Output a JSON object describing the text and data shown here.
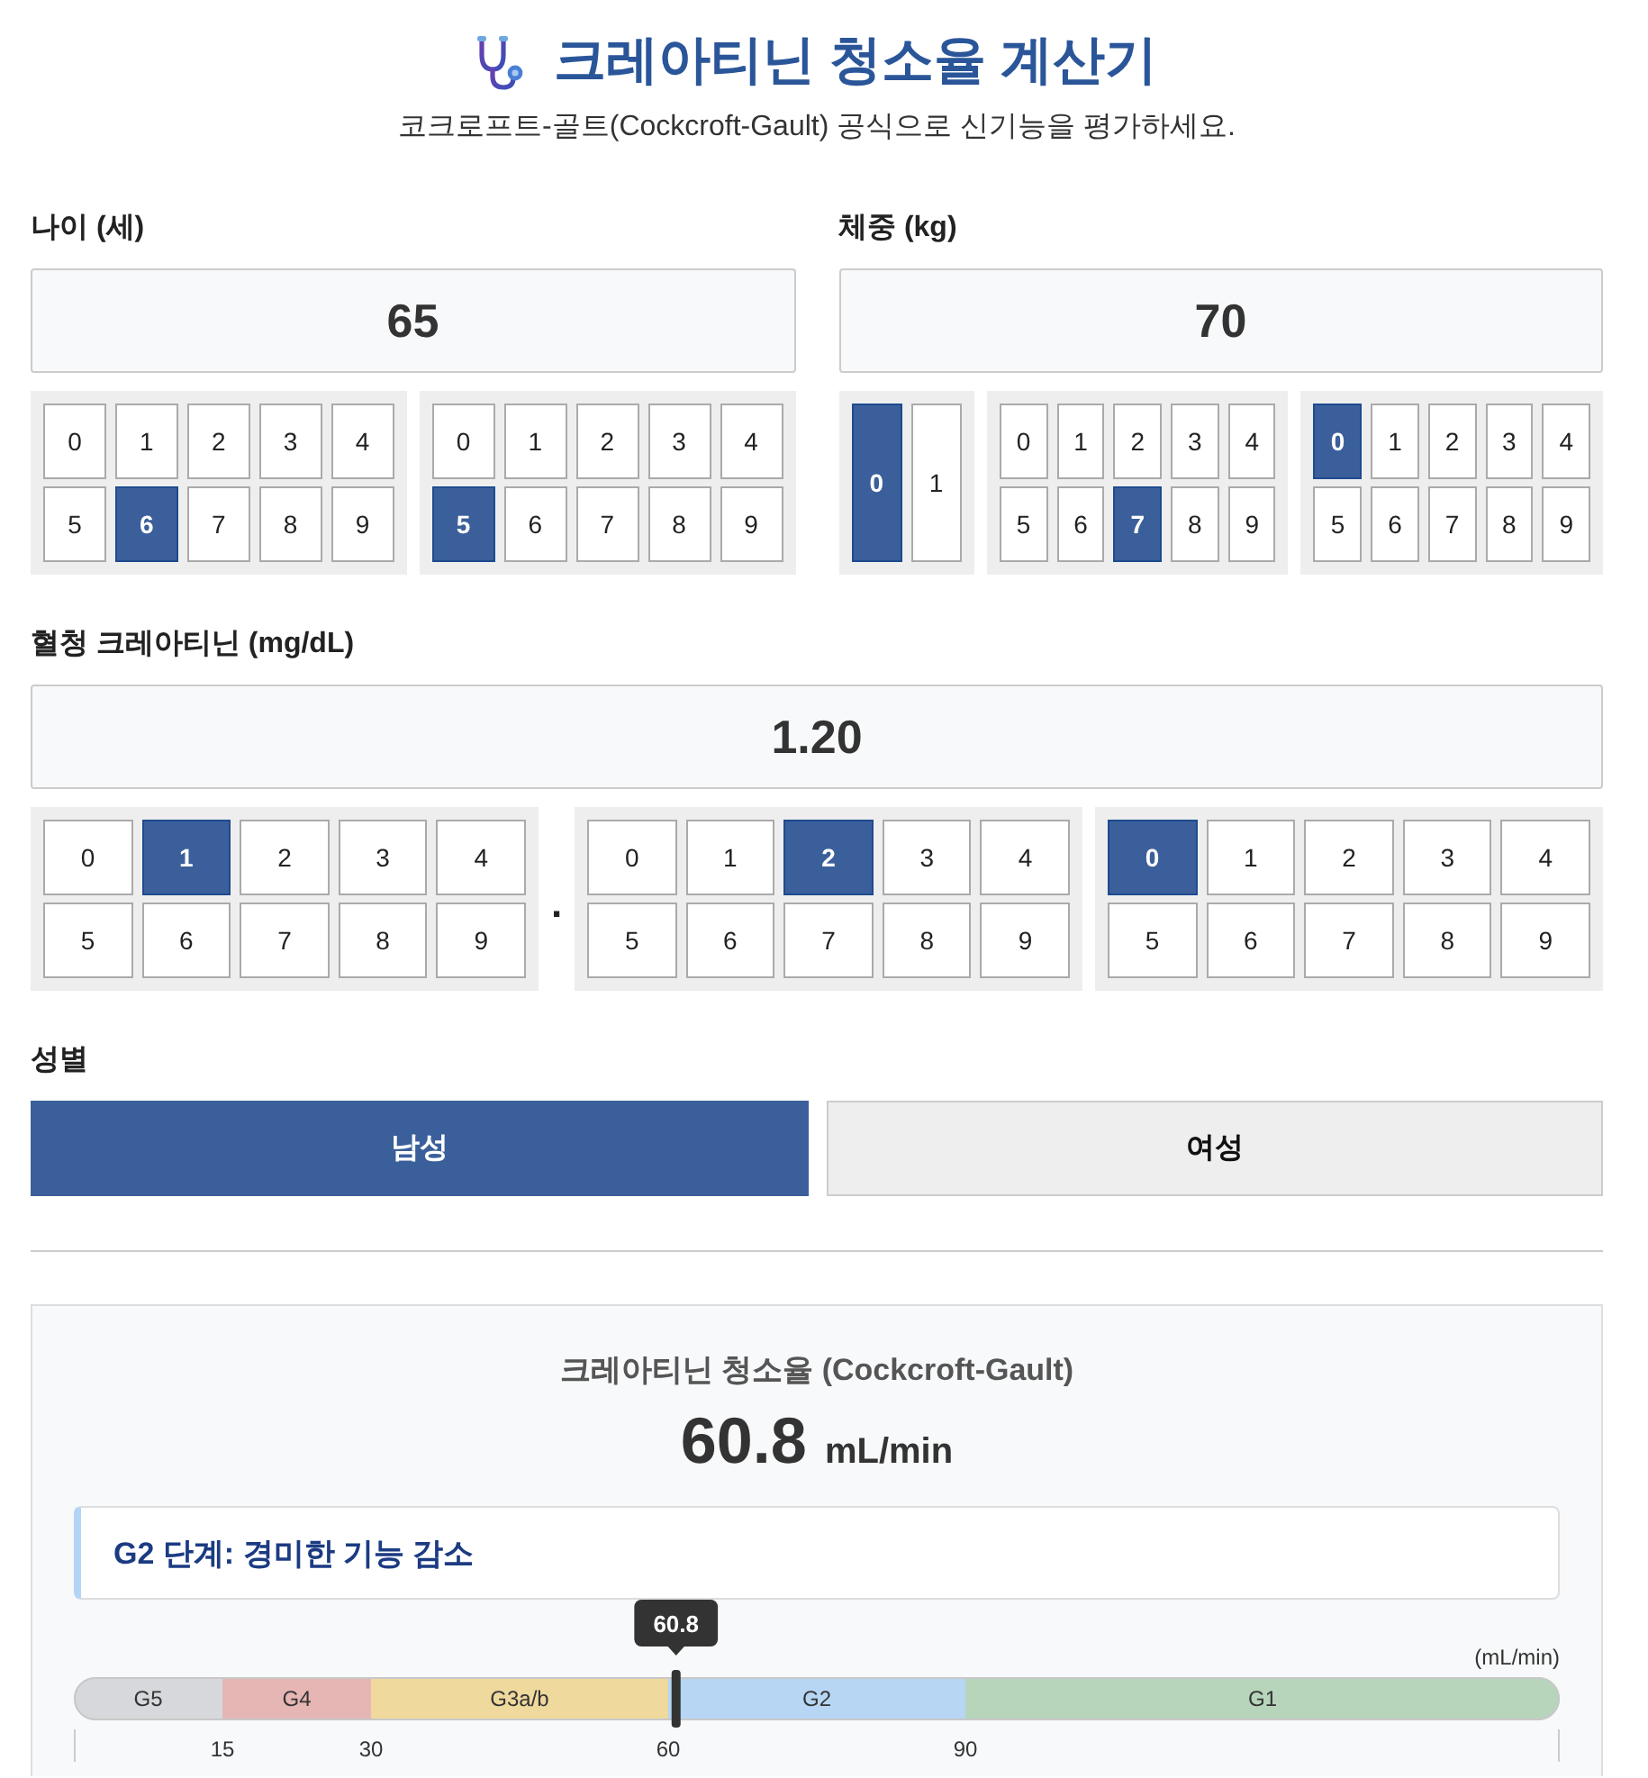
{
  "header": {
    "title": "크레아티닌 청소율 계산기",
    "subtitle": "코크로프트-골트(Cockcroft-Gault) 공식으로 신기능을 평가하세요."
  },
  "age": {
    "label": "나이 (세)",
    "value": "65",
    "pads": [
      {
        "kind": "digits",
        "keys": [
          {
            "label": "0",
            "selected": false
          },
          {
            "label": "1",
            "selected": false
          },
          {
            "label": "2",
            "selected": false
          },
          {
            "label": "3",
            "selected": false
          },
          {
            "label": "4",
            "selected": false
          },
          {
            "label": "5",
            "selected": false
          },
          {
            "label": "6",
            "selected": true
          },
          {
            "label": "7",
            "selected": false
          },
          {
            "label": "8",
            "selected": false
          },
          {
            "label": "9",
            "selected": false
          }
        ]
      },
      {
        "kind": "digits",
        "keys": [
          {
            "label": "0",
            "selected": false
          },
          {
            "label": "1",
            "selected": false
          },
          {
            "label": "2",
            "selected": false
          },
          {
            "label": "3",
            "selected": false
          },
          {
            "label": "4",
            "selected": false
          },
          {
            "label": "5",
            "selected": true
          },
          {
            "label": "6",
            "selected": false
          },
          {
            "label": "7",
            "selected": false
          },
          {
            "label": "8",
            "selected": false
          },
          {
            "label": "9",
            "selected": false
          }
        ]
      }
    ]
  },
  "weight": {
    "label": "체중 (kg)",
    "value": "70",
    "pads": [
      {
        "kind": "digits",
        "keys": [
          {
            "label": "0",
            "selected": true
          },
          {
            "label": "1",
            "selected": false
          }
        ]
      },
      {
        "kind": "digits",
        "keys": [
          {
            "label": "0",
            "selected": false
          },
          {
            "label": "1",
            "selected": false
          },
          {
            "label": "2",
            "selected": false
          },
          {
            "label": "3",
            "selected": false
          },
          {
            "label": "4",
            "selected": false
          },
          {
            "label": "5",
            "selected": false
          },
          {
            "label": "6",
            "selected": false
          },
          {
            "label": "7",
            "selected": true
          },
          {
            "label": "8",
            "selected": false
          },
          {
            "label": "9",
            "selected": false
          }
        ]
      },
      {
        "kind": "digits",
        "keys": [
          {
            "label": "0",
            "selected": true
          },
          {
            "label": "1",
            "selected": false
          },
          {
            "label": "2",
            "selected": false
          },
          {
            "label": "3",
            "selected": false
          },
          {
            "label": "4",
            "selected": false
          },
          {
            "label": "5",
            "selected": false
          },
          {
            "label": "6",
            "selected": false
          },
          {
            "label": "7",
            "selected": false
          },
          {
            "label": "8",
            "selected": false
          },
          {
            "label": "9",
            "selected": false
          }
        ]
      }
    ]
  },
  "creatinine": {
    "label": "혈청 크레아티닌 (mg/dL)",
    "value": "1.20",
    "pads": [
      {
        "kind": "digits",
        "keys": [
          {
            "label": "0",
            "selected": false
          },
          {
            "label": "1",
            "selected": true
          },
          {
            "label": "2",
            "selected": false
          },
          {
            "label": "3",
            "selected": false
          },
          {
            "label": "4",
            "selected": false
          },
          {
            "label": "5",
            "selected": false
          },
          {
            "label": "6",
            "selected": false
          },
          {
            "label": "7",
            "selected": false
          },
          {
            "label": "8",
            "selected": false
          },
          {
            "label": "9",
            "selected": false
          }
        ]
      },
      {
        "kind": "point",
        "text": "."
      },
      {
        "kind": "digits",
        "keys": [
          {
            "label": "0",
            "selected": false
          },
          {
            "label": "1",
            "selected": false
          },
          {
            "label": "2",
            "selected": true
          },
          {
            "label": "3",
            "selected": false
          },
          {
            "label": "4",
            "selected": false
          },
          {
            "label": "5",
            "selected": false
          },
          {
            "label": "6",
            "selected": false
          },
          {
            "label": "7",
            "selected": false
          },
          {
            "label": "8",
            "selected": false
          },
          {
            "label": "9",
            "selected": false
          }
        ]
      },
      {
        "kind": "digits",
        "keys": [
          {
            "label": "0",
            "selected": true
          },
          {
            "label": "1",
            "selected": false
          },
          {
            "label": "2",
            "selected": false
          },
          {
            "label": "3",
            "selected": false
          },
          {
            "label": "4",
            "selected": false
          },
          {
            "label": "5",
            "selected": false
          },
          {
            "label": "6",
            "selected": false
          },
          {
            "label": "7",
            "selected": false
          },
          {
            "label": "8",
            "selected": false
          },
          {
            "label": "9",
            "selected": false
          }
        ]
      }
    ]
  },
  "sex": {
    "label": "성별",
    "options": [
      {
        "label": "남성",
        "selected": true
      },
      {
        "label": "여성",
        "selected": false
      }
    ]
  },
  "result": {
    "title": "크레아티닌 청소율 (Cockcroft-Gault)",
    "value": "60.8",
    "unit": "mL/min",
    "stage": "G2 단계: 경미한 기능 감소",
    "marker": {
      "text": "60.8",
      "level": 0.4053
    },
    "chart_data": {
      "type": "bar",
      "orientation": "horizontal",
      "stacked": true,
      "xlabel": "(mL/min)",
      "xlim": [
        0,
        150
      ],
      "xticks": [
        15,
        30,
        60,
        90
      ],
      "series": [
        {
          "name": "G5",
          "color": "#d6d8dc",
          "values": [
            15
          ]
        },
        {
          "name": "G4",
          "color": "#e6b6b4",
          "values": [
            15
          ]
        },
        {
          "name": "G3a/b",
          "color": "#efd99d",
          "values": [
            30
          ]
        },
        {
          "name": "G2",
          "color": "#b6d6f4",
          "values": [
            30
          ]
        },
        {
          "name": "G1",
          "color": "#b6d5bb",
          "values": [
            60
          ]
        }
      ]
    }
  }
}
